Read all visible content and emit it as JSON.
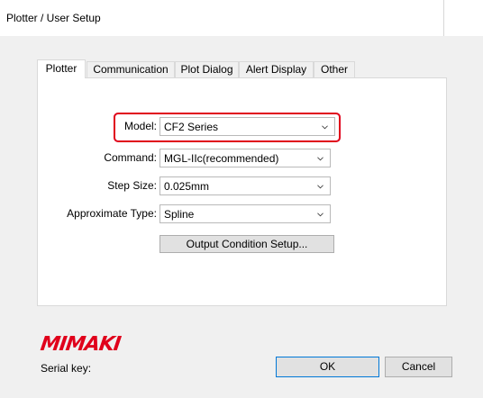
{
  "window": {
    "title": "Plotter / User Setup"
  },
  "tabs": [
    {
      "label": "Plotter",
      "active": true
    },
    {
      "label": "Communication",
      "active": false
    },
    {
      "label": "Plot Dialog",
      "active": false
    },
    {
      "label": "Alert Display",
      "active": false
    },
    {
      "label": "Other",
      "active": false
    }
  ],
  "fields": {
    "model": {
      "label": "Model:",
      "value": "CF2 Series"
    },
    "command": {
      "label": "Command:",
      "value": "MGL-IIc(recommended)"
    },
    "step_size": {
      "label": "Step Size:",
      "value": "0.025mm"
    },
    "approximate_type": {
      "label": "Approximate Type:",
      "value": "Spline"
    }
  },
  "buttons": {
    "output_condition": "Output Condition Setup...",
    "ok": "OK",
    "cancel": "Cancel"
  },
  "brand": {
    "logo_text": "MIMAKI",
    "color": "#e0001b"
  },
  "serial": {
    "label": "Serial key:"
  },
  "colors": {
    "highlight": "#e0001b",
    "default_button_border": "#0078d7"
  },
  "icons": {
    "dropdown": "chevron-down-icon"
  }
}
